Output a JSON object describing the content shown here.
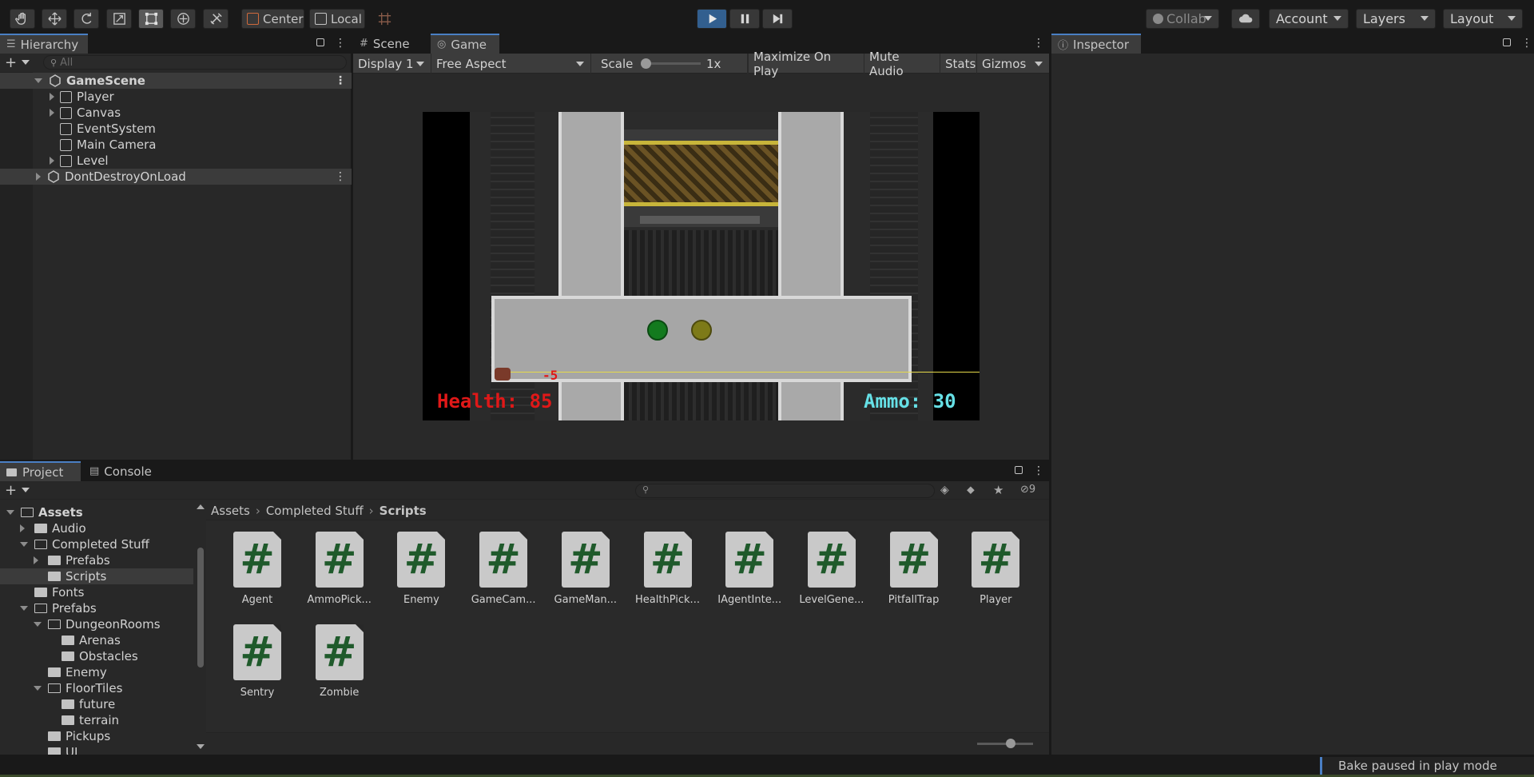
{
  "toolbar": {
    "tools": [
      "hand-tool-icon",
      "move-tool-icon",
      "rotate-tool-icon",
      "scale-tool-icon",
      "rect-tool-icon",
      "transform-tool-icon",
      "custom-tool-icon"
    ],
    "pivot_label": "Center",
    "space_label": "Local",
    "collab_label": "Collab",
    "account_label": "Account",
    "layers_label": "Layers",
    "layout_label": "Layout"
  },
  "hierarchy": {
    "tab_label": "Hierarchy",
    "search_placeholder": "All",
    "scene_name": "GameScene",
    "items": [
      {
        "label": "Player",
        "expandable": true
      },
      {
        "label": "Canvas",
        "expandable": true
      },
      {
        "label": "EventSystem",
        "expandable": false
      },
      {
        "label": "Main Camera",
        "expandable": false
      },
      {
        "label": "Level",
        "expandable": true
      }
    ],
    "dont_destroy": "DontDestroyOnLoad"
  },
  "game_view": {
    "tabs": [
      {
        "label": "Scene",
        "icon": "hash-icon"
      },
      {
        "label": "Game",
        "icon": "gamepad-icon"
      }
    ],
    "display_label": "Display 1",
    "aspect_label": "Free Aspect",
    "scale_label": "Scale",
    "scale_value": "1x",
    "scale_level": 0.0,
    "maximize_label": "Maximize On Play",
    "mute_label": "Mute Audio",
    "stats_label": "Stats",
    "gizmos_label": "Gizmos",
    "hud": {
      "health_text": "Health: 85",
      "ammo_text": "Ammo: 30",
      "damage_text": "-5",
      "health_color": "#e01818",
      "ammo_color": "#66e0e6"
    }
  },
  "inspector": {
    "tab_label": "Inspector"
  },
  "project": {
    "tabs": [
      {
        "label": "Project",
        "icon": "folder-icon"
      },
      {
        "label": "Console",
        "icon": "console-icon"
      }
    ],
    "hidden_count": "9",
    "breadcrumb": [
      "Assets",
      "Completed Stuff",
      "Scripts"
    ],
    "tree": [
      {
        "label": "Assets",
        "depth": 0,
        "arrow": "open",
        "bold": true
      },
      {
        "label": "Audio",
        "depth": 1,
        "arrow": "closed"
      },
      {
        "label": "Completed Stuff",
        "depth": 1,
        "arrow": "open"
      },
      {
        "label": "Prefabs",
        "depth": 2,
        "arrow": "closed"
      },
      {
        "label": "Scripts",
        "depth": 2,
        "arrow": "none",
        "selected": true
      },
      {
        "label": "Fonts",
        "depth": 1,
        "arrow": "none"
      },
      {
        "label": "Prefabs",
        "depth": 1,
        "arrow": "open"
      },
      {
        "label": "DungeonRooms",
        "depth": 2,
        "arrow": "open"
      },
      {
        "label": "Arenas",
        "depth": 3,
        "arrow": "none"
      },
      {
        "label": "Obstacles",
        "depth": 3,
        "arrow": "none"
      },
      {
        "label": "Enemy",
        "depth": 2,
        "arrow": "none"
      },
      {
        "label": "FloorTiles",
        "depth": 2,
        "arrow": "open"
      },
      {
        "label": "future",
        "depth": 3,
        "arrow": "none"
      },
      {
        "label": "terrain",
        "depth": 3,
        "arrow": "none"
      },
      {
        "label": "Pickups",
        "depth": 2,
        "arrow": "none"
      },
      {
        "label": "UI",
        "depth": 2,
        "arrow": "none"
      }
    ],
    "assets": [
      "Agent",
      "AmmoPick...",
      "Enemy",
      "GameCam...",
      "GameMan...",
      "HealthPick...",
      "IAgentInte...",
      "LevelGene...",
      "PitfallTrap",
      "Player",
      "Sentry",
      "Zombie"
    ],
    "asset_glyph": "#"
  },
  "status": {
    "message": "Bake paused in play mode"
  }
}
